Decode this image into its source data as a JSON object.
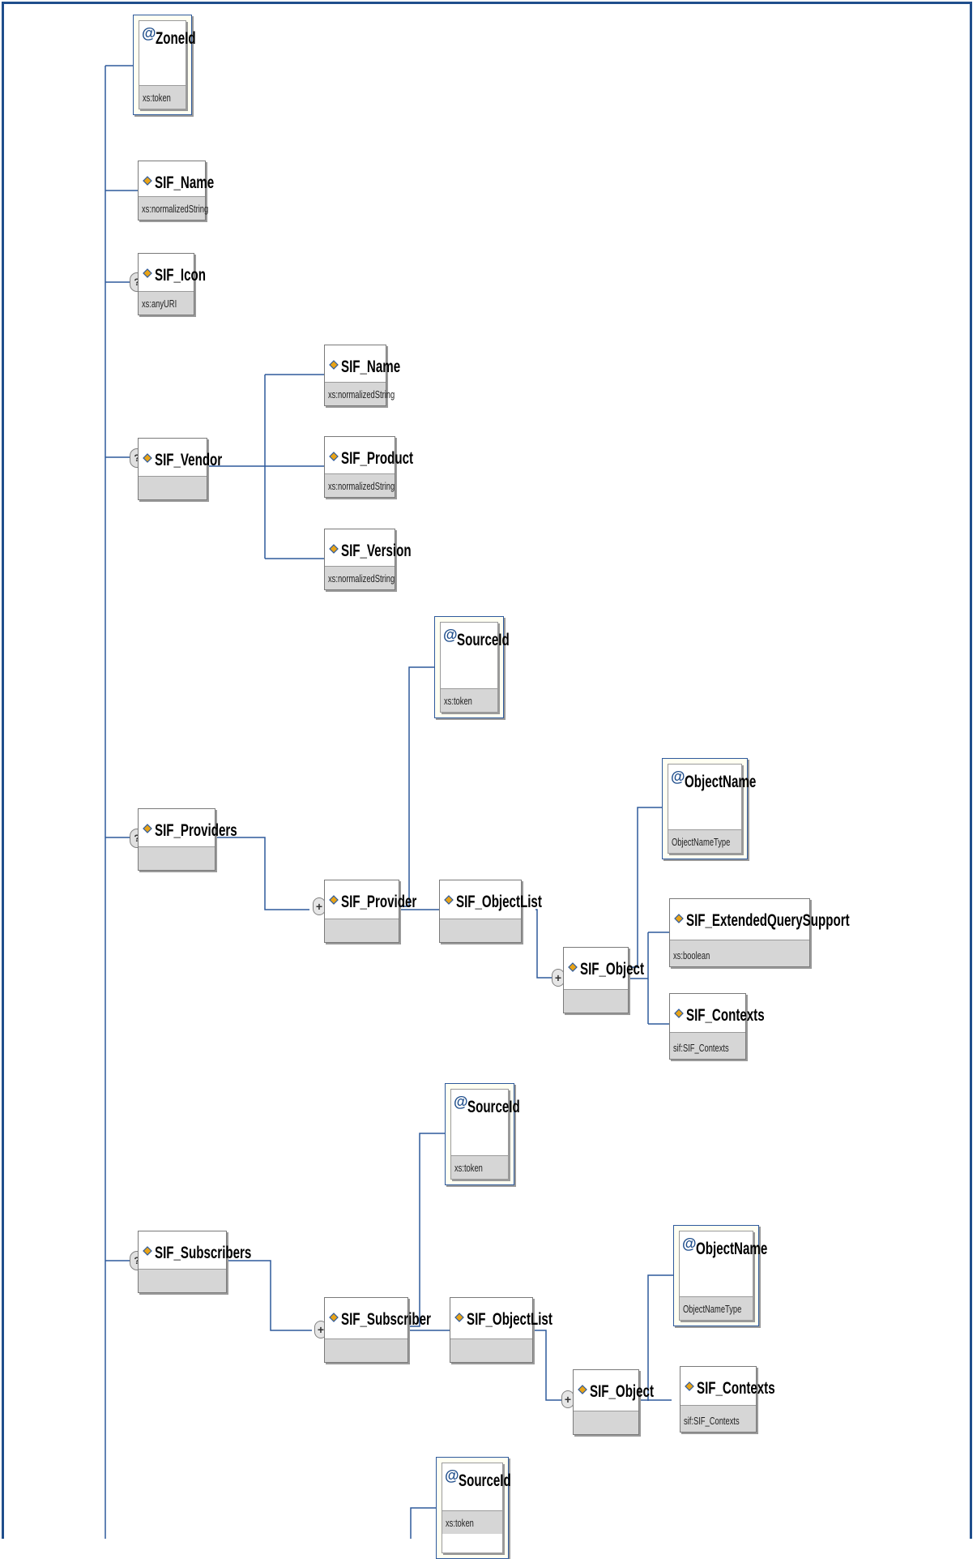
{
  "nodes": {
    "zoneid": {
      "name": "ZoneId",
      "type": "xs:token"
    },
    "sif_name": {
      "name": "SIF_Name",
      "type": "xs:normalizedString"
    },
    "sif_icon": {
      "name": "SIF_Icon",
      "type": "xs:anyURI"
    },
    "sif_vendor": {
      "name": "SIF_Vendor"
    },
    "vendor_name": {
      "name": "SIF_Name",
      "type": "xs:normalizedString"
    },
    "vendor_product": {
      "name": "SIF_Product",
      "type": "xs:normalizedString"
    },
    "vendor_version": {
      "name": "SIF_Version",
      "type": "xs:normalizedString"
    },
    "sif_providers": {
      "name": "SIF_Providers"
    },
    "prov_sourceid": {
      "name": "SourceId",
      "type": "xs:token"
    },
    "sif_provider": {
      "name": "SIF_Provider"
    },
    "prov_objectlist": {
      "name": "SIF_ObjectList"
    },
    "prov_object": {
      "name": "SIF_Object"
    },
    "prov_objectname": {
      "name": "ObjectName",
      "type": "ObjectNameType"
    },
    "prov_extquery": {
      "name": "SIF_ExtendedQuerySupport",
      "type": "xs:boolean"
    },
    "prov_contexts": {
      "name": "SIF_Contexts",
      "type": "sif:SIF_Contexts"
    },
    "sif_subscribers": {
      "name": "SIF_Subscribers"
    },
    "sub_sourceid": {
      "name": "SourceId",
      "type": "xs:token"
    },
    "sif_subscriber": {
      "name": "SIF_Subscriber"
    },
    "sub_objectlist": {
      "name": "SIF_ObjectList"
    },
    "sub_object": {
      "name": "SIF_Object"
    },
    "sub_objectname": {
      "name": "ObjectName",
      "type": "ObjectNameType"
    },
    "sub_contexts": {
      "name": "SIF_Contexts",
      "type": "sif:SIF_Contexts"
    },
    "bottom_sourceid": {
      "name": "SourceId",
      "type": "xs:token"
    }
  },
  "icons": {
    "element": "element-icon",
    "attribute": "at-sign-icon",
    "optional": "question-icon",
    "repeat": "plus-icon"
  },
  "colors": {
    "frame": "#1f4e8c",
    "connector": "#2e5a9c",
    "attribute_fill": "#fffff2"
  }
}
